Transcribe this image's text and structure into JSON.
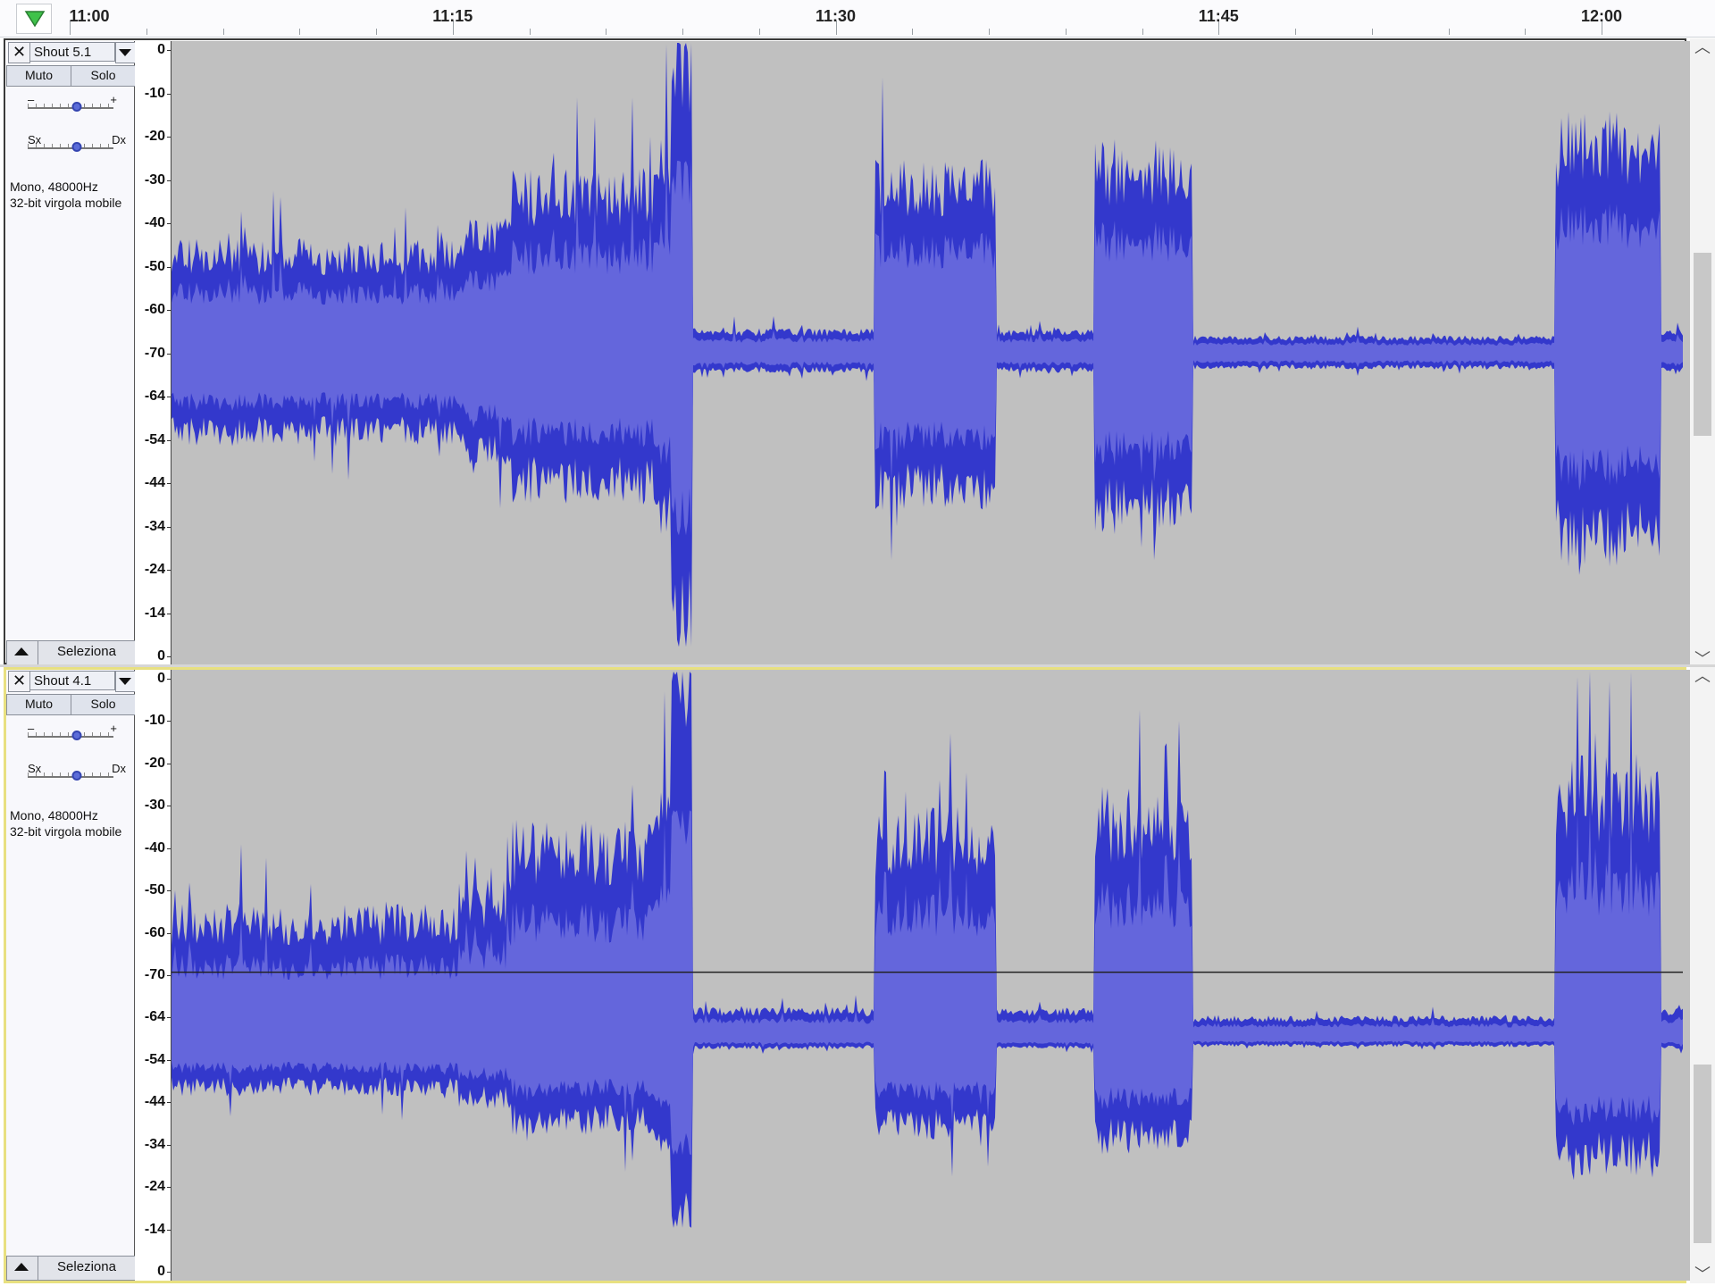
{
  "ruler": {
    "labels": [
      {
        "text": "11:00",
        "pos": 0.0
      },
      {
        "text": "11:15",
        "pos": 0.25
      },
      {
        "text": "11:30",
        "pos": 0.5
      },
      {
        "text": "11:45",
        "pos": 0.75
      },
      {
        "text": "12:00",
        "pos": 1.0
      }
    ]
  },
  "tracks": [
    {
      "name": "Shout 5.1",
      "close": "✕",
      "mute": "Muto",
      "solo": "Solo",
      "gain_minus": "–",
      "gain_plus": "+",
      "pan_left": "Sx",
      "pan_right": "Dx",
      "format_line1": "Mono, 48000Hz",
      "format_line2": "32-bit virgola mobile",
      "select": "Seleziona",
      "scale": [
        "0",
        "-10",
        "-20",
        "-30",
        "-40",
        "-50",
        "-60",
        "-70",
        "-64",
        "-54",
        "-44",
        "-34",
        "-24",
        "-14",
        "0"
      ],
      "selected": false
    },
    {
      "name": "Shout 4.1",
      "close": "✕",
      "mute": "Muto",
      "solo": "Solo",
      "gain_minus": "–",
      "gain_plus": "+",
      "pan_left": "Sx",
      "pan_right": "Dx",
      "format_line1": "Mono, 48000Hz",
      "format_line2": "32-bit virgola mobile",
      "select": "Seleziona",
      "scale": [
        "0",
        "-10",
        "-20",
        "-30",
        "-40",
        "-50",
        "-60",
        "-70",
        "-64",
        "-54",
        "-44",
        "-34",
        "-24",
        "-14",
        "0"
      ],
      "selected": true
    }
  ],
  "colors": {
    "wave_fill": "#6466dc",
    "wave_edge": "#3338cc",
    "wave_bg": "#c0c0c0"
  }
}
